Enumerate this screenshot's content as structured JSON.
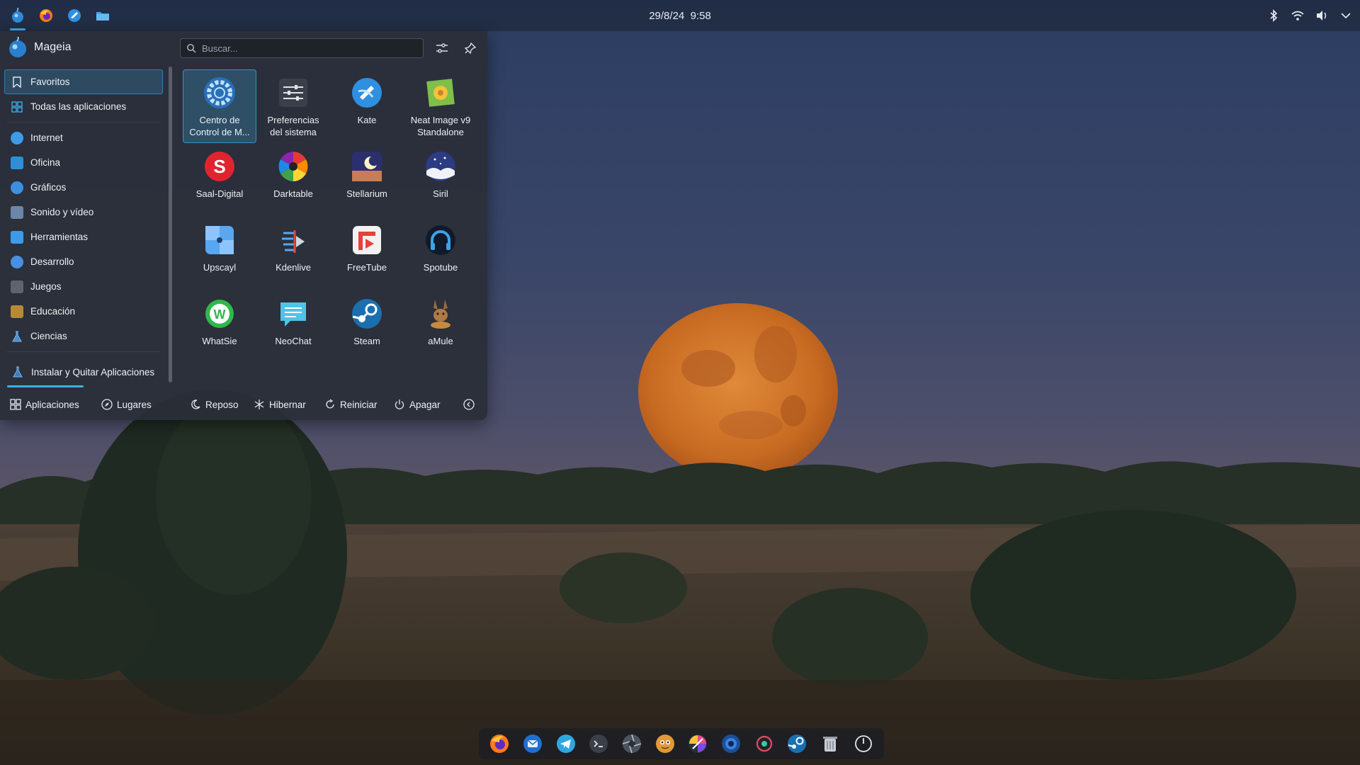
{
  "panel": {
    "date": "29/8/24",
    "time": "9:58",
    "launchers": [
      {
        "name": "mageia-icon"
      },
      {
        "name": "firefox-icon"
      },
      {
        "name": "kate-icon"
      },
      {
        "name": "dolphin-folder-icon"
      }
    ],
    "tray": [
      "bluetooth-icon",
      "wifi-icon",
      "volume-icon",
      "chevron-down-icon"
    ]
  },
  "launcher": {
    "user_name": "Mageia",
    "search_placeholder": "Buscar...",
    "categories": [
      {
        "label": "Favoritos",
        "selected": true,
        "color": "#3daee9"
      },
      {
        "label": "Todas las aplicaciones",
        "color": "#3daee9"
      },
      {
        "label": "Internet",
        "color": "#3d9be9"
      },
      {
        "label": "Oficina",
        "color": "#2f8fd6"
      },
      {
        "label": "Gráficos",
        "color": "#3f8fe0"
      },
      {
        "label": "Sonido y vídeo",
        "color": "#6c86a8"
      },
      {
        "label": "Herramientas",
        "color": "#3d9be9"
      },
      {
        "label": "Desarrollo",
        "color": "#4a90e2"
      },
      {
        "label": "Juegos",
        "color": "#5d6470"
      },
      {
        "label": "Educación",
        "color": "#b9893a"
      },
      {
        "label": "Ciencias",
        "color": "#4a8fd0"
      }
    ],
    "install_label": "Instalar y Quitar Aplicaciones",
    "apps": [
      {
        "label": "Centro de\nControl de M...",
        "icon": "mageia-control-center-icon",
        "selected": true
      },
      {
        "label": "Preferencias\ndel sistema",
        "icon": "system-settings-icon"
      },
      {
        "label": "Kate",
        "icon": "kate-icon"
      },
      {
        "label": "Neat Image v9\nStandalone",
        "icon": "neat-image-icon"
      },
      {
        "label": "Saal-Digital",
        "icon": "saal-digital-icon"
      },
      {
        "label": "Darktable",
        "icon": "darktable-icon"
      },
      {
        "label": "Stellarium",
        "icon": "stellarium-icon"
      },
      {
        "label": "Siril",
        "icon": "siril-icon"
      },
      {
        "label": "Upscayl",
        "icon": "upscayl-icon"
      },
      {
        "label": "Kdenlive",
        "icon": "kdenlive-icon"
      },
      {
        "label": "FreeTube",
        "icon": "freetube-icon"
      },
      {
        "label": "Spotube",
        "icon": "spotube-icon"
      },
      {
        "label": "WhatSie",
        "icon": "whatsie-icon"
      },
      {
        "label": "NeoChat",
        "icon": "neochat-icon"
      },
      {
        "label": "Steam",
        "icon": "steam-icon"
      },
      {
        "label": "aMule",
        "icon": "amule-icon"
      }
    ],
    "footer": {
      "apps_label": "Aplicaciones",
      "places_label": "Lugares",
      "sleep_label": "Reposo",
      "hibernate_label": "Hibernar",
      "restart_label": "Reiniciar",
      "shutdown_label": "Apagar"
    }
  },
  "dock": [
    "firefox-icon",
    "thunderbird-icon",
    "telegram-icon",
    "terminal-icon",
    "aperture-icon",
    "gimp-icon",
    "krita-icon",
    "digikam-icon",
    "davinci-icon",
    "steam-icon",
    "trash-icon",
    "power-icon"
  ]
}
